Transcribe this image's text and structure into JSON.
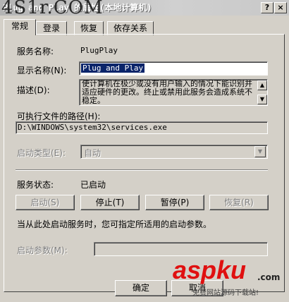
{
  "window": {
    "title": "Plug and Play 的属性(本地计算机)",
    "watermark_top": "4S1r.COM",
    "help_label": "?",
    "close_label": "×"
  },
  "tabs": [
    {
      "label": "常规",
      "active": true
    },
    {
      "label": "登录",
      "active": false
    },
    {
      "label": "恢复",
      "active": false
    },
    {
      "label": "依存关系",
      "active": false
    }
  ],
  "general": {
    "service_name_label": "服务名称:",
    "service_name_value": "PlugPlay",
    "display_name_label": "显示名称(N):",
    "display_name_value": "Plug and Play",
    "description_label": "描述(D):",
    "description_value": "使计算机在极少或没有用户输入的情况下能识别并适应硬件的更改。终止或禁用此服务会造成系统不稳定。",
    "exe_path_label": "可执行文件的路径(H):",
    "exe_path_value": "D:\\WINDOWS\\system32\\services.exe",
    "startup_type_label": "启动类型(E):",
    "startup_type_value": "自动",
    "service_status_label": "服务状态:",
    "service_status_value": "已启动",
    "buttons": {
      "start": "启动(S)",
      "stop": "停止(T)",
      "pause": "暂停(P)",
      "resume": "恢复(R)"
    },
    "hint": "当从此处启动服务时，您可指定所适用的启动参数。",
    "start_params_label": "启动参数(M):",
    "start_params_value": ""
  },
  "footer": {
    "ok_label": "确定",
    "cancel_label": "取消"
  },
  "watermark": {
    "brand": "aspku",
    "brand_suffix": ".com",
    "sub": "免费网站源码下载站!"
  }
}
